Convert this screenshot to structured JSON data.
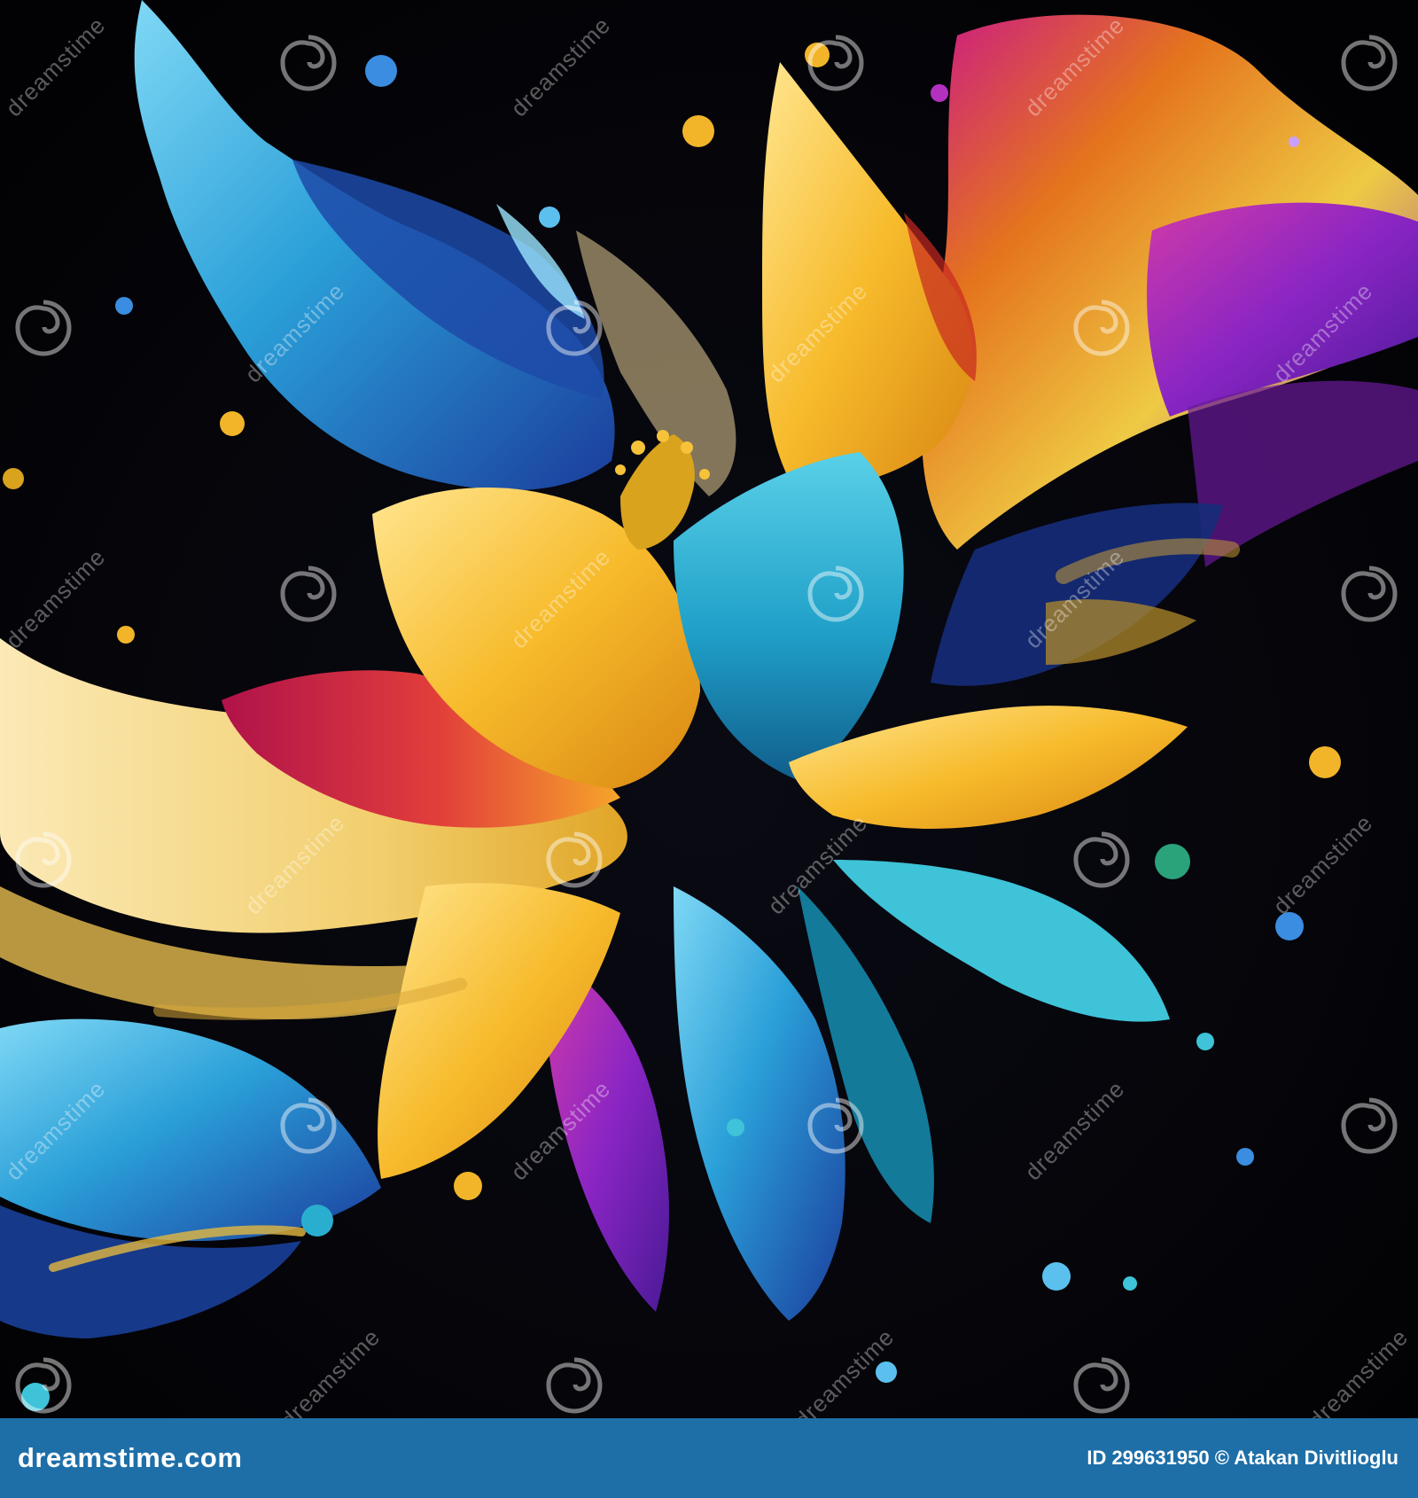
{
  "image": {
    "subject": "abstract flower made of colorful splashing liquid paint",
    "palette": {
      "background": "#030306",
      "gold": "#f5b82a",
      "cyan": "#23a8d6",
      "blue": "#1f5fbf",
      "purple": "#7a1fb5",
      "magenta": "#c21e6e",
      "red": "#d8323a",
      "cream": "#f3d98a"
    }
  },
  "watermark": {
    "text": "dreamstime",
    "icon": "swirl-logo-icon"
  },
  "footer": {
    "brand": "dreamstime.com",
    "id_label": "ID 299631950",
    "copyright": "© Atakan Divitlioglu",
    "background_color": "#1e6fa8"
  }
}
